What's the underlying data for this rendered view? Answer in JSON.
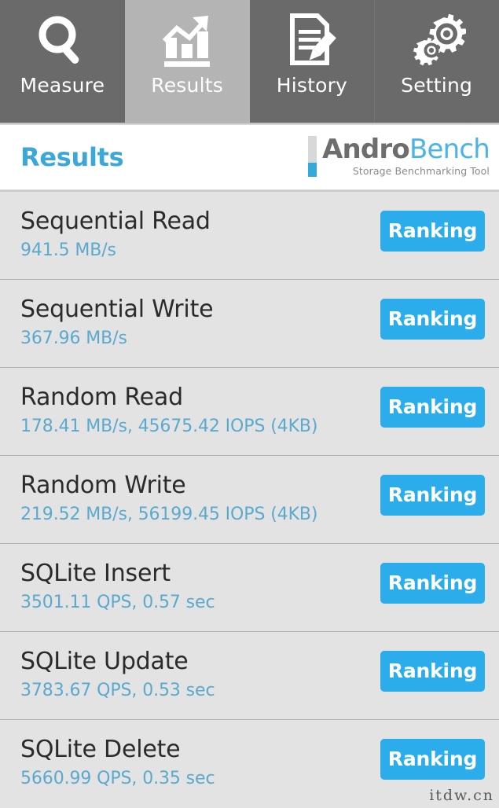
{
  "tabs": [
    {
      "label": "Measure",
      "icon": "magnifier-icon",
      "active": false
    },
    {
      "label": "Results",
      "icon": "bar-chart-trend-icon",
      "active": true
    },
    {
      "label": "History",
      "icon": "document-pencil-icon",
      "active": false
    },
    {
      "label": "Setting",
      "icon": "gears-icon",
      "active": false
    }
  ],
  "header": {
    "title": "Results",
    "logo_primary": "Andro",
    "logo_secondary": "Bench",
    "logo_subtitle": "Storage Benchmarking Tool"
  },
  "results": [
    {
      "title": "Sequential Read",
      "value": "941.5 MB/s",
      "button": "Ranking"
    },
    {
      "title": "Sequential Write",
      "value": "367.96 MB/s",
      "button": "Ranking"
    },
    {
      "title": "Random Read",
      "value": "178.41 MB/s, 45675.42 IOPS (4KB)",
      "button": "Ranking"
    },
    {
      "title": "Random Write",
      "value": "219.52 MB/s, 56199.45 IOPS (4KB)",
      "button": "Ranking"
    },
    {
      "title": "SQLite Insert",
      "value": "3501.11 QPS, 0.57 sec",
      "button": "Ranking"
    },
    {
      "title": "SQLite Update",
      "value": "3783.67 QPS, 0.53 sec",
      "button": "Ranking"
    },
    {
      "title": "SQLite Delete",
      "value": "5660.99 QPS, 0.35 sec",
      "button": "Ranking"
    }
  ],
  "watermark": "itdw.cn",
  "colors": {
    "accent_blue": "#2badeb",
    "title_blue": "#3aa8d8",
    "value_blue": "#5aa9cf",
    "tab_inactive": "#6a6a6a",
    "tab_active": "#b4b4b4",
    "row_bg": "#e3e3e3",
    "row_divider": "#b3b3b3"
  }
}
